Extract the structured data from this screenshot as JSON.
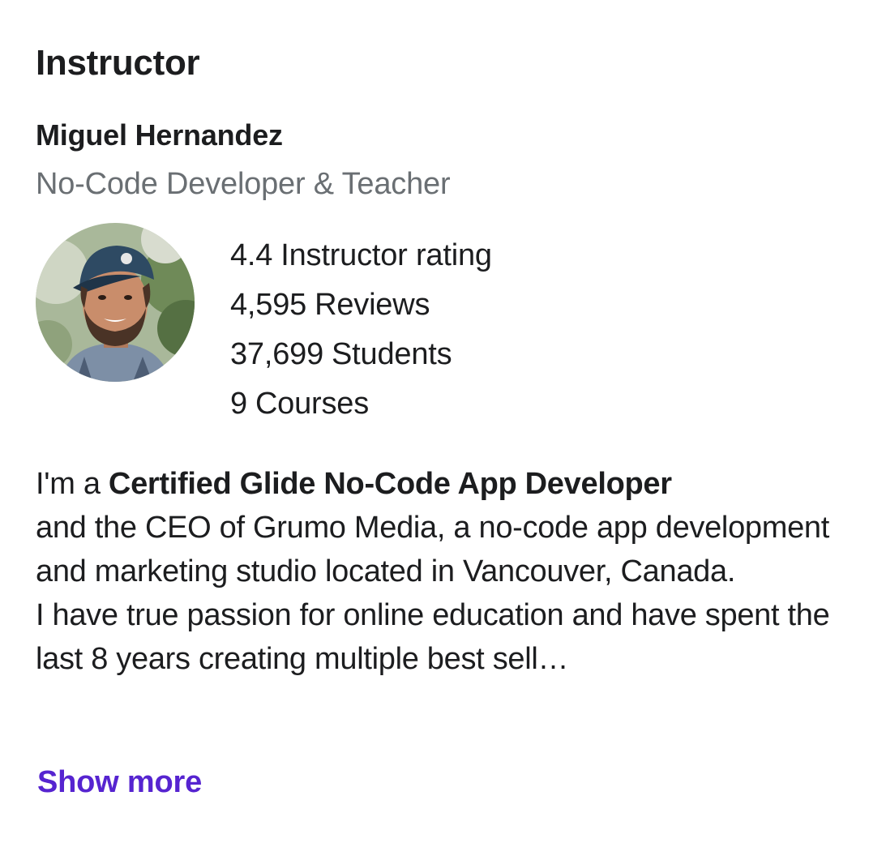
{
  "section": {
    "title": "Instructor"
  },
  "instructor": {
    "name": "Miguel Hernandez",
    "headline": "No-Code Developer & Teacher",
    "avatar_alt": "Instructor photo"
  },
  "stats": [
    {
      "value": "4.4",
      "label": "Instructor rating"
    },
    {
      "value": "4,595",
      "label": "Reviews"
    },
    {
      "value": "37,699",
      "label": "Students"
    },
    {
      "value": "9",
      "label": "Courses"
    }
  ],
  "bio": {
    "intro": "I'm a ",
    "highlight": "Certified Glide No-Code App Developer",
    "line1_rest": "and the CEO of Grumo Media, a no-code app development and marketing studio located in Vancouver, Canada.",
    "line2": "I have true passion for online education and have spent the last 8 years creating multiple best sell…"
  },
  "actions": {
    "show_more_label": "Show more"
  },
  "colors": {
    "text": "#1c1d1f",
    "muted": "#6a6f73",
    "link": "#5624d0"
  }
}
